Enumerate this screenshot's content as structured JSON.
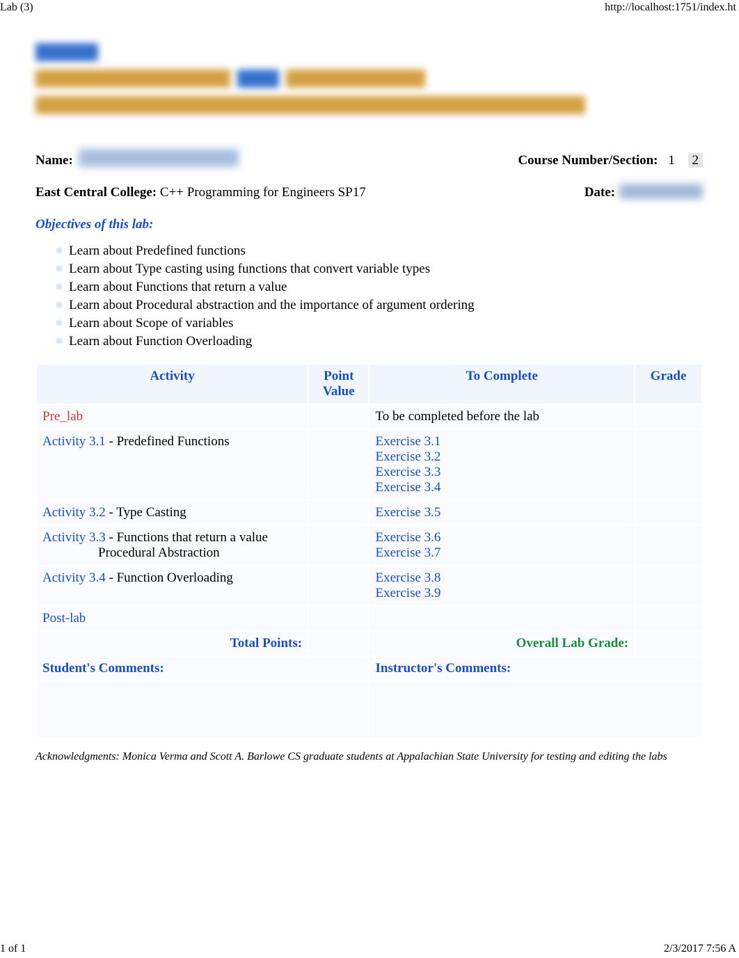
{
  "topbar": {
    "left": "Lab (3)",
    "right": "http://localhost:1751/index.ht"
  },
  "redacted": {
    "a": "",
    "b": "",
    "c": ""
  },
  "header": {
    "name_label": "Name:",
    "course_label": "Course Number/Section:",
    "course_opt1": "1",
    "course_opt2": "2",
    "ecc_label": "East Central College:",
    "ecc_value": "C++ Programming for Engineers SP17",
    "date_label": "Date:"
  },
  "objectives": {
    "heading": "Objectives of this lab:",
    "items": [
      "Learn about Predefined functions",
      "Learn about Type casting using functions that convert variable types",
      "Learn about Functions that return a value",
      "Learn about Procedural abstraction and the importance of argument ordering",
      "Learn about Scope of variables",
      "Learn about Function Overloading"
    ]
  },
  "table": {
    "headers": {
      "activity": "Activity",
      "point_value": "Point Value",
      "to_complete": "To Complete",
      "grade": "Grade"
    },
    "rows": [
      {
        "activity_link": "Pre_lab",
        "activity_tail": "",
        "to_complete": "To be completed before the lab",
        "to_complete_links": []
      },
      {
        "activity_link": "Activity 3.1",
        "activity_tail": " - Predefined Functions",
        "to_complete_links": [
          "Exercise 3.1",
          "Exercise 3.2",
          "Exercise 3.3",
          "Exercise 3.4"
        ]
      },
      {
        "activity_link": "Activity 3.2",
        "activity_tail": " - Type Casting",
        "to_complete_links": [
          "Exercise 3.5"
        ]
      },
      {
        "activity_link": "Activity 3.3",
        "activity_tail": " - Functions that return a value",
        "activity_sub": "Procedural Abstraction",
        "to_complete_links": [
          "Exercise 3.6",
          "Exercise 3.7"
        ]
      },
      {
        "activity_link": "Activity 3.4",
        "activity_tail": " - Function Overloading",
        "to_complete_links": [
          "Exercise 3.8",
          "Exercise 3.9"
        ]
      },
      {
        "activity_link": "Post-lab",
        "activity_tail": "",
        "to_complete_links": []
      }
    ],
    "total_points_label": "Total Points:",
    "overall_grade_label": "Overall Lab Grade:",
    "student_comments": "Student's Comments:",
    "instructor_comments": "Instructor's Comments:"
  },
  "ack": "Acknowledgments: Monica Verma and Scott A. Barlowe CS graduate students at Appalachian State University for testing and editing the labs",
  "footer": {
    "left": "1 of 1",
    "right": "2/3/2017 7:56 A"
  }
}
